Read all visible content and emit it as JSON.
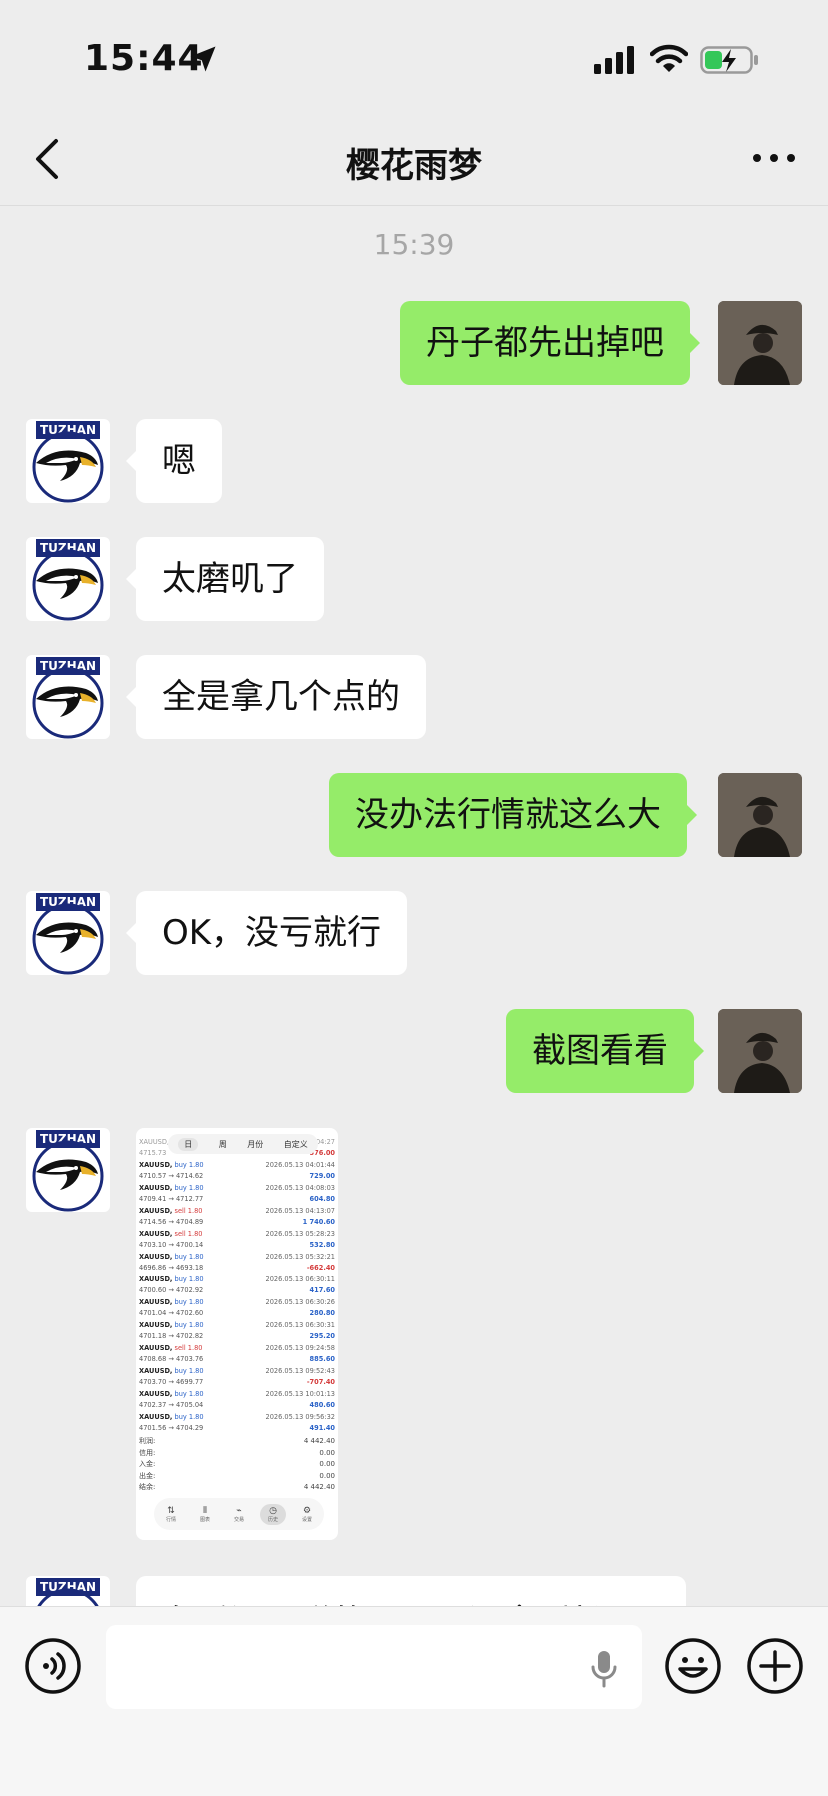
{
  "status_bar": {
    "time": "15:44"
  },
  "nav": {
    "title": "樱花雨梦"
  },
  "timestamp": "15:39",
  "contact_badge": "TUZHAN",
  "messages": [
    {
      "side": "right",
      "text": "丹子都先出掉吧"
    },
    {
      "side": "left",
      "text": "嗯"
    },
    {
      "side": "left",
      "text": "太磨叽了"
    },
    {
      "side": "left",
      "text": "全是拿几个点的"
    },
    {
      "side": "right",
      "text": "没办法行情就这么大"
    },
    {
      "side": "left",
      "text": "OK，没亏就行"
    },
    {
      "side": "right",
      "text": "截图看看"
    },
    {
      "side": "left",
      "text": "车后还是赚的，只是没拿到长"
    }
  ],
  "screenshot": {
    "tabs": [
      "日",
      "周",
      "月份",
      "自定义"
    ],
    "header_partial": {
      "symbol": "XAUUSD, s",
      "prices": "4715.73",
      "date": "5 13 05:04:27",
      "profit": "-576.00"
    },
    "trades": [
      {
        "symbol": "XAUUSD,",
        "side": "buy 1.80",
        "prices": "4710.57 → 4714.62",
        "date": "2026.05.13 04:01:44",
        "profit": "729.00",
        "positive": true
      },
      {
        "symbol": "XAUUSD,",
        "side": "buy 1.80",
        "prices": "4709.41 → 4712.77",
        "date": "2026.05.13 04:08:03",
        "profit": "604.80",
        "positive": true
      },
      {
        "symbol": "XAUUSD,",
        "side": "sell 1.80",
        "prices": "4714.56 → 4704.89",
        "date": "2026.05.13 04:13:07",
        "profit": "1 740.60",
        "positive": true
      },
      {
        "symbol": "XAUUSD,",
        "side": "sell 1.80",
        "prices": "4703.10 → 4700.14",
        "date": "2026.05.13 05:28:23",
        "profit": "532.80",
        "positive": true
      },
      {
        "symbol": "XAUUSD,",
        "side": "buy 1.80",
        "prices": "4696.86 → 4693.18",
        "date": "2026.05.13 05:32:21",
        "profit": "-662.40",
        "positive": false
      },
      {
        "symbol": "XAUUSD,",
        "side": "buy 1.80",
        "prices": "4700.60 → 4702.92",
        "date": "2026.05.13 06:30:11",
        "profit": "417.60",
        "positive": true
      },
      {
        "symbol": "XAUUSD,",
        "side": "buy 1.80",
        "prices": "4701.04 → 4702.60",
        "date": "2026.05.13 06:30:26",
        "profit": "280.80",
        "positive": true
      },
      {
        "symbol": "XAUUSD,",
        "side": "buy 1.80",
        "prices": "4701.18 → 4702.82",
        "date": "2026.05.13 06:30:31",
        "profit": "295.20",
        "positive": true
      },
      {
        "symbol": "XAUUSD,",
        "side": "sell 1.80",
        "prices": "4708.68 → 4703.76",
        "date": "2026.05.13 09:24:58",
        "profit": "885.60",
        "positive": true
      },
      {
        "symbol": "XAUUSD,",
        "side": "buy 1.80",
        "prices": "4703.70 → 4699.77",
        "date": "2026.05.13 09:52:43",
        "profit": "-707.40",
        "positive": false
      },
      {
        "symbol": "XAUUSD,",
        "side": "buy 1.80",
        "prices": "4702.37 → 4705.04",
        "date": "2026.05.13 10:01:13",
        "profit": "480.60",
        "positive": true
      },
      {
        "symbol": "XAUUSD,",
        "side": "buy 1.80",
        "prices": "4701.56 → 4704.29",
        "date": "2026.05.13 09:56:32",
        "profit": "491.40",
        "positive": true
      }
    ],
    "summary": [
      {
        "label": "利润:",
        "value": "4 442.40"
      },
      {
        "label": "信用:",
        "value": "0.00"
      },
      {
        "label": "入金:",
        "value": "0.00"
      },
      {
        "label": "出金:",
        "value": "0.00"
      },
      {
        "label": "结余:",
        "value": "4 442.40"
      }
    ],
    "bottom_nav": [
      "行情",
      "图表",
      "交易",
      "历史",
      "设置"
    ]
  },
  "colors": {
    "bubble_green": "#95ec69",
    "bubble_white": "#ffffff",
    "background": "#ededed",
    "badge_navy": "#1a2a7a",
    "profit_blue": "#2a62c7",
    "loss_red": "#d43b3b"
  }
}
